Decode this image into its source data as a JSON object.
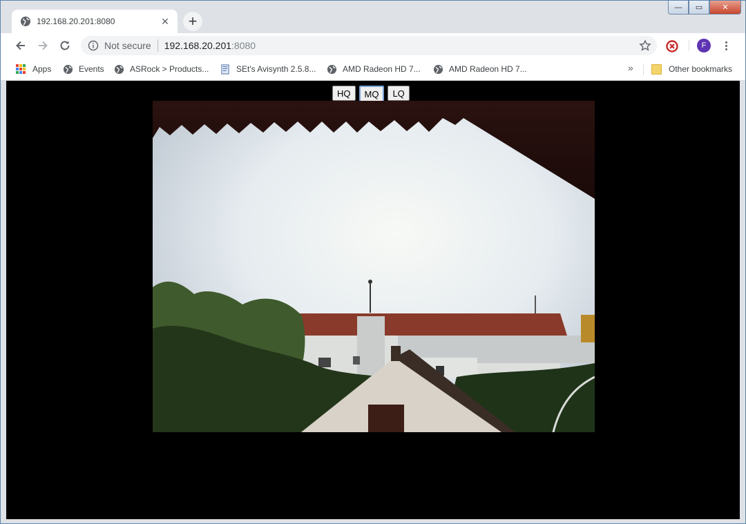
{
  "tab": {
    "title": "192.168.20.201:8080",
    "new_tab_symbol": "+",
    "close_symbol": "✕"
  },
  "window_controls": {
    "minimize": "—",
    "maximize": "▭",
    "close": "✕"
  },
  "toolbar": {
    "security_label": "Not secure",
    "url_host": "192.168.20.201",
    "url_port": ":8080",
    "avatar_letter": "F"
  },
  "bookmarks": {
    "items": [
      {
        "label": "Apps",
        "icon": "apps-grid-icon"
      },
      {
        "label": "Events",
        "icon": "globe-icon"
      },
      {
        "label": "ASRock > Products...",
        "icon": "globe-icon"
      },
      {
        "label": "SEt's Avisynth 2.5.8...",
        "icon": "page-icon"
      },
      {
        "label": "AMD Radeon HD 7...",
        "icon": "globe-icon"
      },
      {
        "label": "AMD Radeon HD 7...",
        "icon": "globe-icon"
      }
    ],
    "overflow": "»",
    "other_bookmarks": "Other bookmarks"
  },
  "page": {
    "quality_buttons": [
      "HQ",
      "MQ",
      "LQ"
    ],
    "selected_quality": "MQ"
  },
  "colors": {
    "page_background": "#000000",
    "avatar": "#5e35b1",
    "selected_button_border": "#7ba3d6"
  }
}
